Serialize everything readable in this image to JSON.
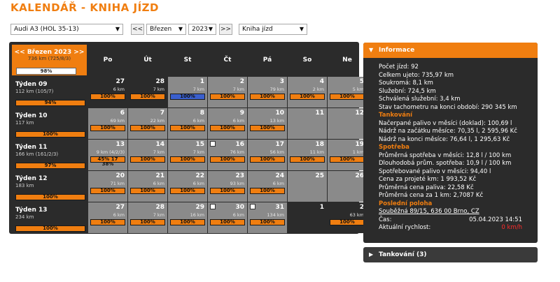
{
  "page_title": "KALENDÁŘ - KNIHA JÍZD",
  "toolbar": {
    "vehicle": "Audi A3 (HOL 35-13)",
    "prev": "<<",
    "month": "Březen",
    "year": "2023",
    "next": ">>",
    "view": "Kniha jízd"
  },
  "calendar": {
    "corner": {
      "month": "<< Březen 2023 >>",
      "sub": "736 km (725/8/3)",
      "percent": "98%"
    },
    "day_headers": [
      "Po",
      "Út",
      "St",
      "Čt",
      "Pá",
      "So",
      "Ne"
    ],
    "weeks": [
      {
        "title": "Týden 09",
        "sub": "112 km (105/7)",
        "percent": "94%",
        "days": [
          {
            "n": "27",
            "km": "6 km",
            "p": "100%",
            "t": "out"
          },
          {
            "n": "28",
            "km": "7 km",
            "p": "100%",
            "t": "out"
          },
          {
            "n": "1",
            "km": "7 km",
            "p": "100%",
            "t": "cur",
            "blue": true
          },
          {
            "n": "2",
            "km": "7 km",
            "p": "100%",
            "t": "cur"
          },
          {
            "n": "3",
            "km": "79 km",
            "p": "100%",
            "t": "cur"
          },
          {
            "n": "4",
            "km": "2 km",
            "p": "100%",
            "t": "cur"
          },
          {
            "n": "5",
            "km": "5 km",
            "p": "100%",
            "t": "cur"
          }
        ]
      },
      {
        "title": "Týden 10",
        "sub": "117 km",
        "percent": "100%",
        "days": [
          {
            "n": "6",
            "km": "69 km",
            "p": "100%",
            "t": "cur"
          },
          {
            "n": "7",
            "km": "22 km",
            "p": "100%",
            "t": "cur"
          },
          {
            "n": "8",
            "km": "6 km",
            "p": "100%",
            "t": "cur"
          },
          {
            "n": "9",
            "km": "6 km",
            "p": "100%",
            "t": "cur"
          },
          {
            "n": "10",
            "km": "13 km",
            "p": "100%",
            "t": "cur"
          },
          {
            "n": "11",
            "km": "",
            "p": "",
            "t": "cur"
          },
          {
            "n": "12",
            "km": "",
            "p": "",
            "t": "cur"
          }
        ]
      },
      {
        "title": "Týden 11",
        "sub": "166 km (161/2/3)",
        "percent": "97%",
        "days": [
          {
            "n": "13",
            "km": "9 km (4/2/3)",
            "p": "45%  17  38%",
            "t": "cur"
          },
          {
            "n": "14",
            "km": "7 km",
            "p": "100%",
            "t": "cur"
          },
          {
            "n": "15",
            "km": "7 km",
            "p": "100%",
            "t": "cur"
          },
          {
            "n": "16",
            "km": "76 km",
            "p": "100%",
            "t": "cur",
            "note": true
          },
          {
            "n": "17",
            "km": "56 km",
            "p": "100%",
            "t": "cur"
          },
          {
            "n": "18",
            "km": "11 km",
            "p": "100%",
            "t": "cur"
          },
          {
            "n": "19",
            "km": "1 km",
            "p": "100%",
            "t": "cur"
          }
        ]
      },
      {
        "title": "Týden 12",
        "sub": "183 km",
        "percent": "100%",
        "days": [
          {
            "n": "20",
            "km": "71 km",
            "p": "100%",
            "t": "cur"
          },
          {
            "n": "21",
            "km": "6 km",
            "p": "100%",
            "t": "cur"
          },
          {
            "n": "22",
            "km": "6 km",
            "p": "100%",
            "t": "cur"
          },
          {
            "n": "23",
            "km": "93 km",
            "p": "100%",
            "t": "cur"
          },
          {
            "n": "24",
            "km": "6 km",
            "p": "100%",
            "t": "cur"
          },
          {
            "n": "25",
            "km": "",
            "p": "",
            "t": "cur"
          },
          {
            "n": "26",
            "km": "",
            "p": "",
            "t": "cur"
          }
        ]
      },
      {
        "title": "Týden 13",
        "sub": "234 km",
        "percent": "100%",
        "days": [
          {
            "n": "27",
            "km": "6 km",
            "p": "100%",
            "t": "cur"
          },
          {
            "n": "28",
            "km": "7 km",
            "p": "100%",
            "t": "cur"
          },
          {
            "n": "29",
            "km": "16 km",
            "p": "100%",
            "t": "cur"
          },
          {
            "n": "30",
            "km": "6 km",
            "p": "100%",
            "t": "cur",
            "note": true
          },
          {
            "n": "31",
            "km": "134 km",
            "p": "100%",
            "t": "cur",
            "note": true
          },
          {
            "n": "1",
            "km": "",
            "p": "",
            "t": "out"
          },
          {
            "n": "2",
            "km": "63 km",
            "p": "100%",
            "t": "out"
          }
        ]
      }
    ]
  },
  "info_panel": {
    "header": "Informace",
    "lines1": [
      "Počet jízd: 92",
      "Celkem ujeto: 735,97 km",
      "Soukromá: 8,1 km",
      "Služební: 724,5 km",
      "Schválená služební: 3,4 km",
      "Stav tachometru na konci období: 290 345 km"
    ],
    "tank_title": "Tankování",
    "tank_lines": [
      "Načerpané palivo v měsíci (doklad): 100,69 l",
      "Nádrž na začátku měsíce: 70,35 l, 2 595,96 Kč",
      "Nádrž na konci měsíce: 76,64 l, 1 295,63 Kč"
    ],
    "cons_title": "Spotřeba",
    "cons_lines": [
      "Průměrná spotřeba v měsíci: 12,8 l / 100 km",
      "Dlouhodobá prům. spotřeba: 10,9 l / 100 km",
      "Spotřebované palivo v měsíci: 94,40 l",
      "Cena za projeté km: 1 993,52 Kč",
      "Průměrná cena paliva: 22,58 Kč",
      "Průměrná cena za 1 km: 2,7087 Kč"
    ],
    "pos_title": "Poslední poloha",
    "address": "Souběžná 89/15, 636 00 Brno, CZ",
    "time_label": "Čas:",
    "time_value": "05.04.2023 14:51",
    "speed_label": "Aktuální rychlost:",
    "speed_value": "0 km/h"
  },
  "tank_panel": {
    "header": "Tankování (3)"
  },
  "colors": {
    "accent": "#f07e10",
    "panel": "#2b2b2b",
    "day": "#8a8a8a",
    "speed": "#ff2a2a"
  }
}
